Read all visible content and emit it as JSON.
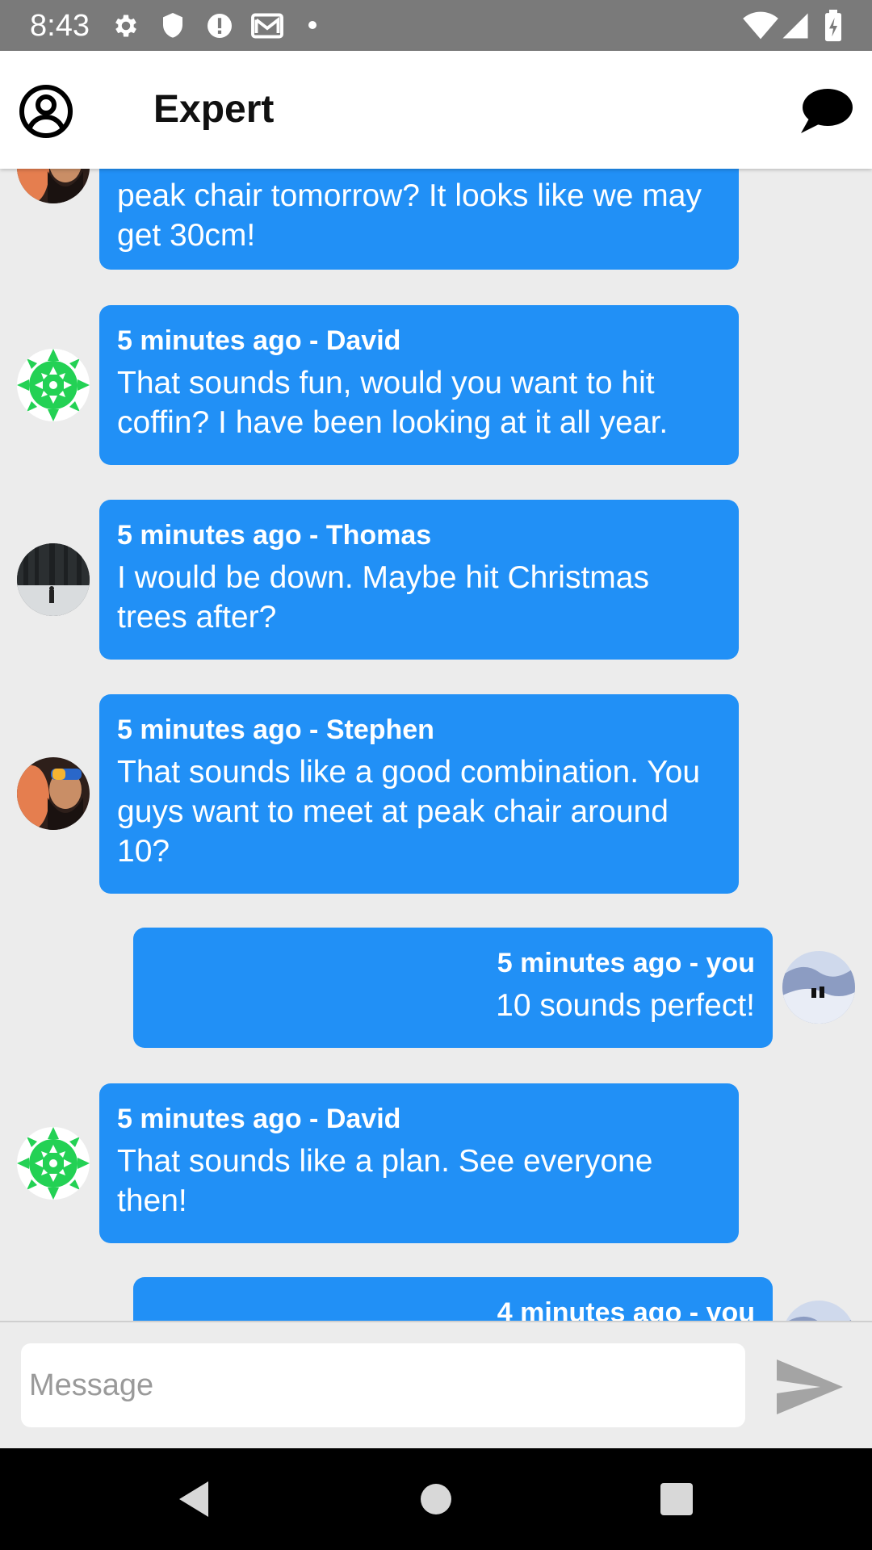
{
  "status_bar": {
    "time": "8:43",
    "left_icons": [
      "gear-icon",
      "shield-icon",
      "alert-icon",
      "mail-icon",
      "dot-icon"
    ],
    "right_icons": [
      "wifi-icon",
      "signal-icon",
      "battery-charging-icon"
    ]
  },
  "app_bar": {
    "title": "Expert",
    "left_icon": "account-circle-icon",
    "right_icon": "chat-bubble-icon"
  },
  "colors": {
    "bubble": "#2190f6",
    "status_bar": "#7a7a7a",
    "chat_background": "#ececec"
  },
  "messages": [
    {
      "meta": "",
      "text": "peak chair tomorrow?  It looks like we may get 30cm!",
      "sender": "Stephen",
      "avatar": "avatar-stephen",
      "mine": false,
      "partial": true
    },
    {
      "meta": "5 minutes ago - David",
      "text": "That sounds fun, would you want to hit coffin?  I have been looking at it all year.",
      "sender": "David",
      "avatar": "avatar-david",
      "mine": false
    },
    {
      "meta": "5 minutes ago - Thomas",
      "text": "I would be down.  Maybe hit Christmas trees after?",
      "sender": "Thomas",
      "avatar": "avatar-thomas",
      "mine": false
    },
    {
      "meta": "5 minutes ago - Stephen",
      "text": "That sounds like a good combination. You guys want to meet at peak chair around 10?",
      "sender": "Stephen",
      "avatar": "avatar-stephen",
      "mine": false
    },
    {
      "meta": "5 minutes ago - you",
      "text": "10 sounds perfect!",
      "sender": "you",
      "avatar": "avatar-you",
      "mine": true
    },
    {
      "meta": "5 minutes ago - David",
      "text": "That sounds like a plan.  See everyone then!",
      "sender": "David",
      "avatar": "avatar-david",
      "mine": false
    },
    {
      "meta": "4 minutes ago - you",
      "text": "",
      "sender": "you",
      "avatar": "avatar-you",
      "mine": true,
      "partial": true
    }
  ],
  "input": {
    "placeholder": "Message",
    "value": "",
    "send_icon": "send-icon"
  },
  "nav_bar": {
    "buttons": [
      "back-icon",
      "home-icon",
      "recents-icon"
    ]
  }
}
